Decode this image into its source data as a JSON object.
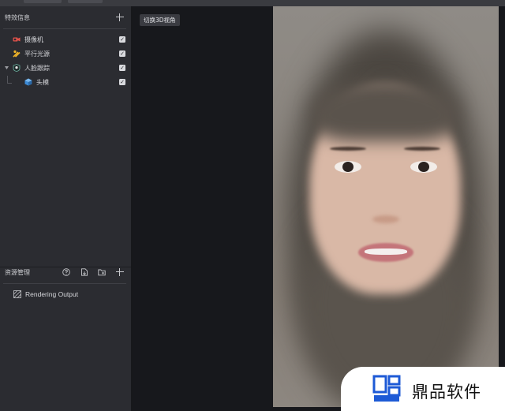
{
  "effects_panel": {
    "title": "特效信息",
    "items": [
      {
        "label": "摄像机",
        "icon": "camera-icon",
        "checked": true
      },
      {
        "label": "平行光源",
        "icon": "directional-light-icon",
        "checked": true
      },
      {
        "label": "人脸跟踪",
        "icon": "face-tracking-icon",
        "checked": true,
        "expanded": true
      },
      {
        "label": "头模",
        "icon": "head-model-icon",
        "checked": true
      }
    ],
    "check_glyph": "✓"
  },
  "resources_panel": {
    "title": "资源管理",
    "items": [
      {
        "label": "Rendering Output",
        "icon": "render-output-icon"
      }
    ]
  },
  "viewport": {
    "toggle_3d_label": "切换3D视角"
  },
  "watermark": {
    "text": "鼎品软件"
  },
  "colors": {
    "panel_bg": "#2b2c31",
    "viewport_bg": "#17181c",
    "camera_icon": "#e5534b",
    "light_icon": "#f0b429",
    "model_icon": "#3d8bd6"
  }
}
